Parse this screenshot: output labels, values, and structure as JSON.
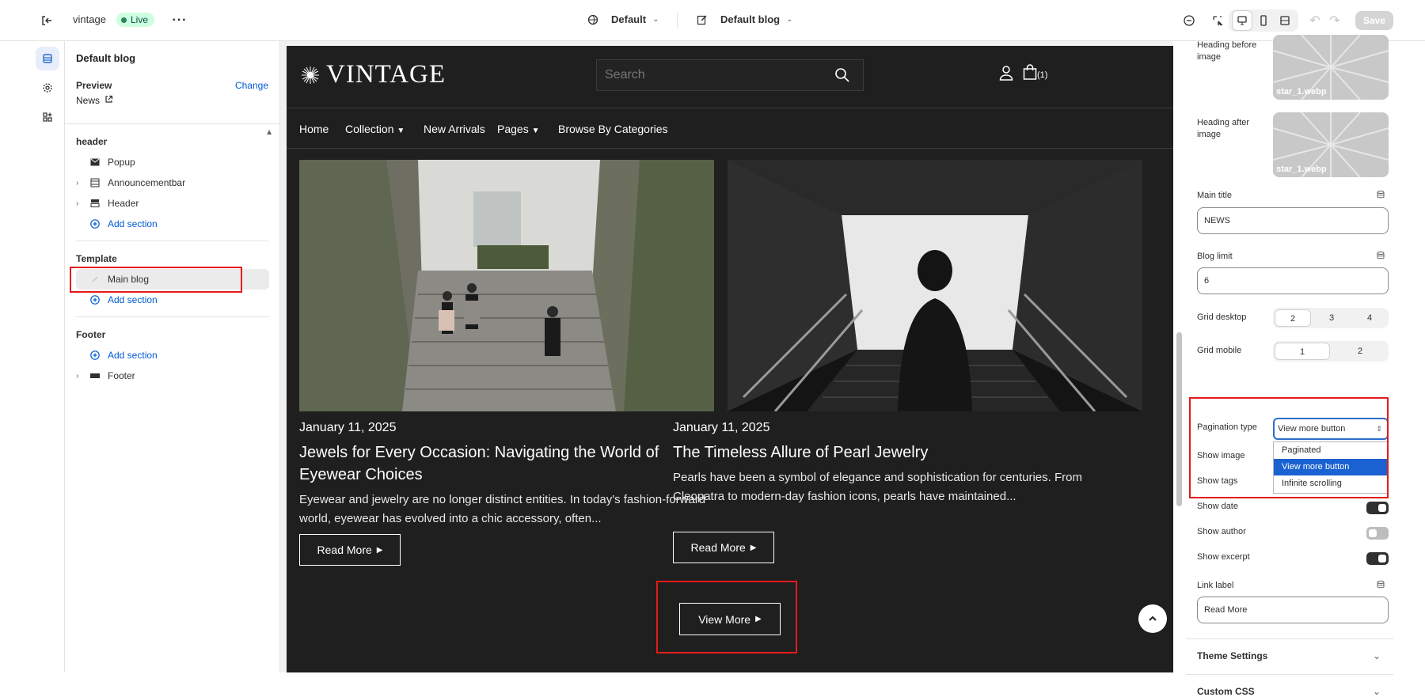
{
  "topbar": {
    "store_name": "vintage",
    "live_label": "Live",
    "theme_select": "Default",
    "template_select": "Default blog",
    "save_label": "Save"
  },
  "left": {
    "title": "Default blog",
    "preview_label": "Preview",
    "change_label": "Change",
    "preview_value": "News",
    "header_section": "header",
    "header_items": [
      "Popup",
      "Announcementbar",
      "Header"
    ],
    "add_section": "Add section",
    "template_section": "Template",
    "template_item": "Main blog",
    "footer_section": "Footer",
    "footer_item": "Footer"
  },
  "site": {
    "logo": "VINTAGE",
    "search_placeholder": "Search",
    "cart_count": "(1)",
    "nav": [
      "Home",
      "Collection",
      "New Arrivals",
      "Pages",
      "Browse By Categories"
    ],
    "posts": [
      {
        "date": "January 11, 2025",
        "title": "Jewels for Every Occasion: Navigating the World of Eyewear Choices",
        "excerpt": "Eyewear and jewelry are no longer distinct entities. In today's fashion-forward world, eyewear has evolved into a chic accessory, often...",
        "link": "Read More"
      },
      {
        "date": "January 11, 2025",
        "title": "The Timeless Allure of Pearl Jewelry",
        "excerpt": "Pearls have been a symbol of elegance and sophistication for centuries. From Cleopatra to modern-day fashion icons, pearls have maintained...",
        "link": "Read More"
      }
    ],
    "view_more": "View More"
  },
  "right": {
    "heading_before_image": "Heading before image",
    "heading_after_image": "Heading after image",
    "image_file": "star_1.webp",
    "main_title_label": "Main title",
    "main_title_value": "NEWS",
    "blog_limit_label": "Blog limit",
    "blog_limit_value": "6",
    "grid_desktop_label": "Grid desktop",
    "grid_desktop_options": [
      "2",
      "3",
      "4"
    ],
    "grid_mobile_label": "Grid mobile",
    "grid_mobile_options": [
      "1",
      "2"
    ],
    "pagination_label": "Pagination type",
    "pagination_value": "View more button",
    "pagination_options": [
      "Paginated",
      "View more button",
      "Infinite scrolling"
    ],
    "show_image": "Show image",
    "show_tags": "Show tags",
    "show_date": "Show date",
    "show_author": "Show author",
    "show_excerpt": "Show excerpt",
    "link_label_label": "Link label",
    "link_label_value": "Read More",
    "theme_settings": "Theme Settings",
    "custom_css": "Custom CSS"
  },
  "colors": {
    "accent": "#005bd3",
    "highlight": "#e41b1b",
    "site_bg": "#1f1f1f",
    "live_badge": "#cdfee1"
  }
}
